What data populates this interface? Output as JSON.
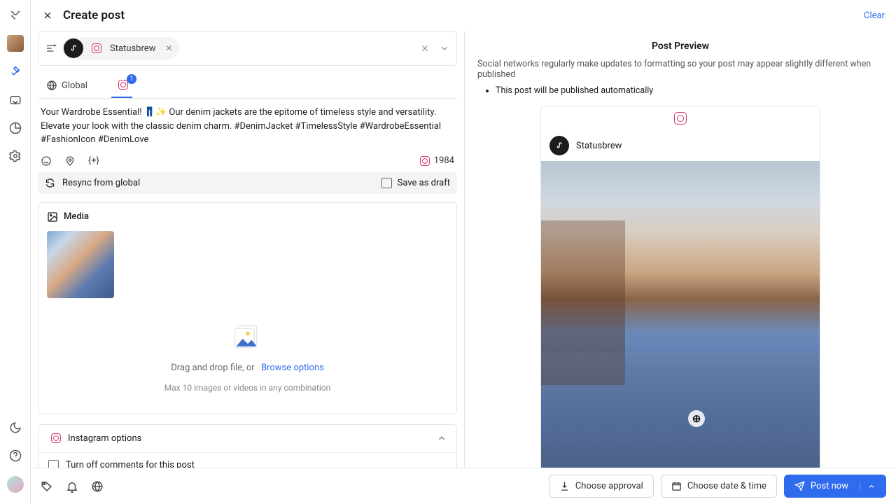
{
  "header": {
    "title": "Create post",
    "clear_label": "Clear"
  },
  "profile": {
    "name": "Statusbrew"
  },
  "tabs": {
    "global_label": "Global",
    "ig_badge": "1"
  },
  "composer": {
    "text": "Your Wardrobe Essential! 👖✨ Our denim jackets are the epitome of timeless style and versatility. Elevate your look with the classic denim charm. #DenimJacket #TimelessStyle #WardrobeEssential #FashionIcon #DenimLove",
    "char_count": "1984"
  },
  "sync": {
    "resync_label": "Resync from global",
    "draft_label": "Save as draft"
  },
  "media": {
    "title": "Media",
    "drop_text": "Drag and drop file, or",
    "browse_label": "Browse options",
    "limit_text": "Max 10 images or videos in any combination"
  },
  "ig_options": {
    "title": "Instagram options",
    "turn_off_comments": "Turn off comments for this post"
  },
  "preview": {
    "title": "Post Preview",
    "note": "Social networks regularly make updates to formatting so your post may appear slightly different when published",
    "bullet": "This post will be published automatically",
    "account": "Statusbrew"
  },
  "footer": {
    "approval_label": "Choose approval",
    "schedule_label": "Choose date & time",
    "post_label": "Post now"
  }
}
